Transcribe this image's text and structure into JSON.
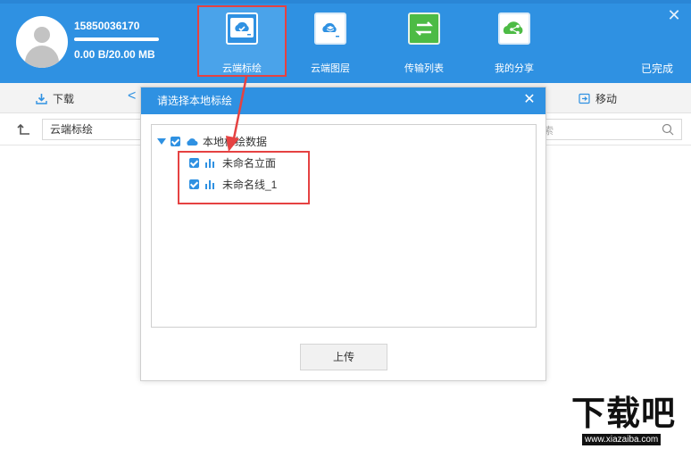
{
  "user": {
    "id": "15850036170",
    "quota": "0.00 B/20.00 MB",
    "quota_fraction": 0.0
  },
  "nav": {
    "items": [
      {
        "label": "云端标绘",
        "icon": "cloud-plot-icon",
        "active": true
      },
      {
        "label": "云端图层",
        "icon": "cloud-layer-icon",
        "active": false
      },
      {
        "label": "传输列表",
        "icon": "transfer-icon",
        "active": false
      },
      {
        "label": "我的分享",
        "icon": "share-icon",
        "active": false
      }
    ],
    "done_label": "已完成"
  },
  "toolbar": {
    "download_label": "下载",
    "move_label": "移动"
  },
  "pathbar": {
    "path": "云端标绘",
    "search_hint": "索"
  },
  "dialog": {
    "title": "请选择本地标绘",
    "tree": {
      "root_label": "本地标绘数据",
      "children": [
        "未命名立面",
        "未命名线_1"
      ]
    },
    "upload_label": "上传"
  },
  "watermark": {
    "brand": "下载吧",
    "url": "www.xiazaiba.com"
  },
  "colors": {
    "primary": "#2f91e2",
    "highlight": "#e54242",
    "green": "#4dbb45"
  }
}
